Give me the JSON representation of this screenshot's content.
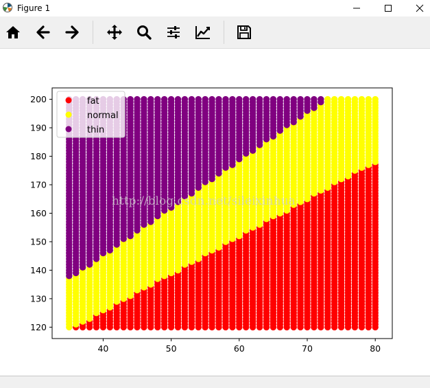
{
  "window": {
    "title": "Figure 1"
  },
  "toolbar": {
    "buttons": [
      {
        "name": "home-button",
        "icon": "home-icon"
      },
      {
        "name": "back-button",
        "icon": "arrow-left-icon"
      },
      {
        "name": "forward-button",
        "icon": "arrow-right-icon"
      },
      {
        "name": "pan-button",
        "icon": "move-icon"
      },
      {
        "name": "zoom-button",
        "icon": "magnifier-icon"
      },
      {
        "name": "configure-subplots-button",
        "icon": "sliders-icon"
      },
      {
        "name": "edit-axes-button",
        "icon": "line-chart-icon"
      },
      {
        "name": "save-button",
        "icon": "floppy-disk-icon"
      }
    ]
  },
  "watermark": "http://blog.csdn.net/sileixinhua",
  "chart_data": {
    "type": "scatter",
    "title": "",
    "xlabel": "",
    "ylabel": "",
    "xlim": [
      32.5,
      82.5
    ],
    "ylim": [
      116,
      204
    ],
    "x_ticks": [
      40,
      50,
      60,
      70,
      80
    ],
    "y_ticks": [
      120,
      130,
      140,
      150,
      160,
      170,
      180,
      190,
      200
    ],
    "grid": false,
    "legend_position": "top-left",
    "x_range": [
      35,
      80
    ],
    "y_range": [
      120,
      200
    ],
    "series": [
      {
        "name": "fat",
        "color": "#ff0000"
      },
      {
        "name": "normal",
        "color": "#ffff00"
      },
      {
        "name": "thin",
        "color": "#800080"
      }
    ],
    "boundaries": {
      "fat_normal": {
        "at_x_35": 119,
        "at_x_80": 178
      },
      "normal_thin": {
        "at_x_35": 137,
        "at_x_73": 200
      }
    }
  }
}
